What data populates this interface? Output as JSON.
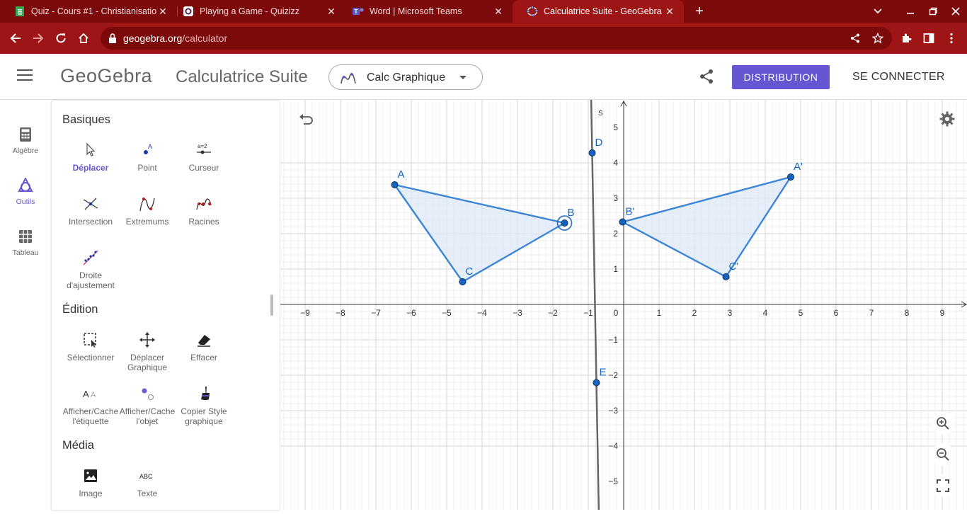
{
  "browser": {
    "tabs": [
      {
        "title": "Quiz - Cours #1 - Christianisatio",
        "icon": "google-forms-icon"
      },
      {
        "title": "Playing a Game - Quizizz",
        "icon": "quizizz-icon"
      },
      {
        "title": "Word | Microsoft Teams",
        "icon": "teams-icon"
      },
      {
        "title": "Calculatrice Suite - GeoGebra",
        "icon": "geogebra-icon",
        "active": true
      }
    ],
    "url_host": "geogebra.org",
    "url_path": "/calculator",
    "accent": "#9e1515"
  },
  "header": {
    "logo": "GeoGebra",
    "app_title": "Calculatrice Suite",
    "app_select": "Calc Graphique",
    "distribution_label": "DISTRIBUTION",
    "signin_label": "SE CONNECTER",
    "brand_color": "#6557d2"
  },
  "rail": {
    "items": [
      {
        "label": "Algèbre",
        "icon": "calculator-icon"
      },
      {
        "label": "Outils",
        "icon": "tools-icon",
        "active": true
      },
      {
        "label": "Tableau",
        "icon": "table-icon"
      }
    ]
  },
  "tools": {
    "sections": [
      {
        "title": "Basiques",
        "items": [
          {
            "label": "Déplacer",
            "icon": "move-cursor-icon",
            "active": true
          },
          {
            "label": "Point",
            "icon": "point-icon"
          },
          {
            "label": "Curseur",
            "icon": "slider-icon"
          },
          {
            "label": "Intersection",
            "icon": "intersection-icon"
          },
          {
            "label": "Extremums",
            "icon": "extremum-icon"
          },
          {
            "label": "Racines",
            "icon": "roots-icon"
          },
          {
            "label": "Droite d'ajustement",
            "icon": "best-fit-line-icon"
          }
        ]
      },
      {
        "title": "Édition",
        "items": [
          {
            "label": "Sélectionner",
            "icon": "select-icon"
          },
          {
            "label": "Déplacer Graphique",
            "icon": "move-graphics-icon"
          },
          {
            "label": "Effacer",
            "icon": "eraser-icon"
          },
          {
            "label": "Afficher/Cache l'étiquette",
            "icon": "show-hide-label-icon"
          },
          {
            "label": "Afficher/Cache l'objet",
            "icon": "show-hide-object-icon"
          },
          {
            "label": "Copier Style graphique",
            "icon": "copy-style-icon"
          }
        ]
      },
      {
        "title": "Média",
        "items": [
          {
            "label": "Image",
            "icon": "image-icon"
          },
          {
            "label": "Texte",
            "icon": "text-icon"
          }
        ]
      }
    ]
  },
  "graph": {
    "x_ticks": [
      "−9",
      "−8",
      "−7",
      "−6",
      "−5",
      "−4",
      "−3",
      "−2",
      "−1",
      "0",
      "1",
      "2",
      "3",
      "4",
      "5",
      "6",
      "7",
      "8",
      "9"
    ],
    "y_ticks": [
      "5",
      "4",
      "3",
      "2",
      "1",
      "−1",
      "−2",
      "−3",
      "−4",
      "−5"
    ],
    "line_label": "s",
    "points": [
      {
        "name": "A",
        "x": -6.47,
        "y": 3.38
      },
      {
        "name": "B",
        "x": -1.67,
        "y": 2.3
      },
      {
        "name": "C",
        "x": -4.55,
        "y": 0.64
      },
      {
        "name": "A'",
        "x": 4.72,
        "y": 3.6
      },
      {
        "name": "B'",
        "x": -0.03,
        "y": 2.33
      },
      {
        "name": "C'",
        "x": 2.89,
        "y": 0.78
      },
      {
        "name": "D",
        "x": -0.89,
        "y": 4.28
      },
      {
        "name": "E",
        "x": -0.77,
        "y": -2.21
      }
    ],
    "triangles": [
      [
        "A",
        "B",
        "C"
      ],
      [
        "A'",
        "B'",
        "C'"
      ]
    ],
    "line_through": [
      "D",
      "E"
    ],
    "colors": {
      "poly_stroke": "#3d85d6",
      "poly_fill": "#dde8f7",
      "point": "#1565c0",
      "line": "#666666"
    }
  }
}
